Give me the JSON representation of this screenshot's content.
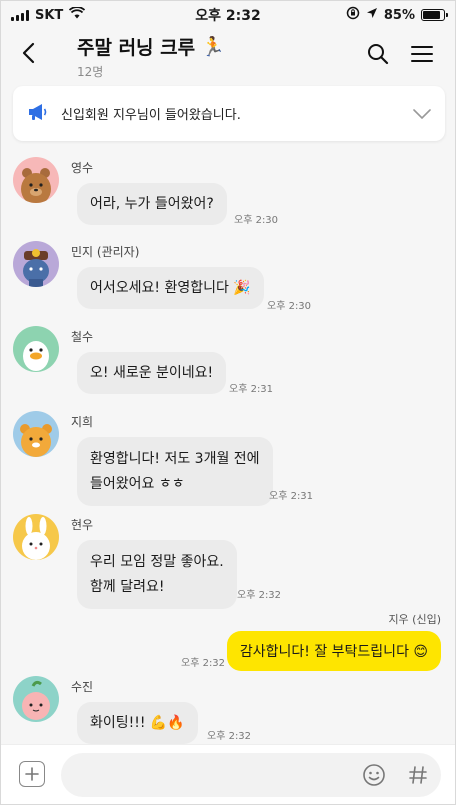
{
  "status": {
    "carrier": "SKT",
    "time": "오후 2:32",
    "battery": "85%",
    "battery_level": 0.85
  },
  "header": {
    "title": "주말 러닝 크루",
    "title_emoji": "🏃",
    "members": "12명"
  },
  "notice": {
    "text": "신입회원 지우님이 들어왔습니다."
  },
  "messages": [
    {
      "sender": "영수",
      "text": "어라, 누가 들어왔어?",
      "time": "오후 2:30",
      "avatar": "bear"
    },
    {
      "sender": "민지 (관리자)",
      "text": "어서오세요! 환영합니다 🎉",
      "time": "오후 2:30",
      "avatar": "purple"
    },
    {
      "sender": "철수",
      "text": "오! 새로운 분이네요!",
      "time": "오후 2:31",
      "avatar": "duck"
    },
    {
      "sender": "지희",
      "line1": "환영합니다! 저도 3개월 전에",
      "line2": "들어왔어요 ㅎㅎ",
      "time": "오후 2:31",
      "avatar": "lion"
    },
    {
      "sender": "현우",
      "line1": "우리 모임 정말 좋아요.",
      "line2": "함께 달려요!",
      "time": "오후 2:32",
      "avatar": "rabbit"
    },
    {
      "sender": "수진",
      "text": "화이팅!!! 💪🔥",
      "time": "오후 2:32",
      "avatar": "peach"
    }
  ],
  "my_message": {
    "name": "지우 (신입)",
    "text": "감사합니다! 잘 부탁드립니다 😊",
    "time": "오후 2:32"
  },
  "input": {
    "placeholder": ""
  },
  "colors": {
    "my_bubble": "#fee500",
    "background": "#f6f6f6",
    "notice_icon": "#2f6fe4"
  }
}
